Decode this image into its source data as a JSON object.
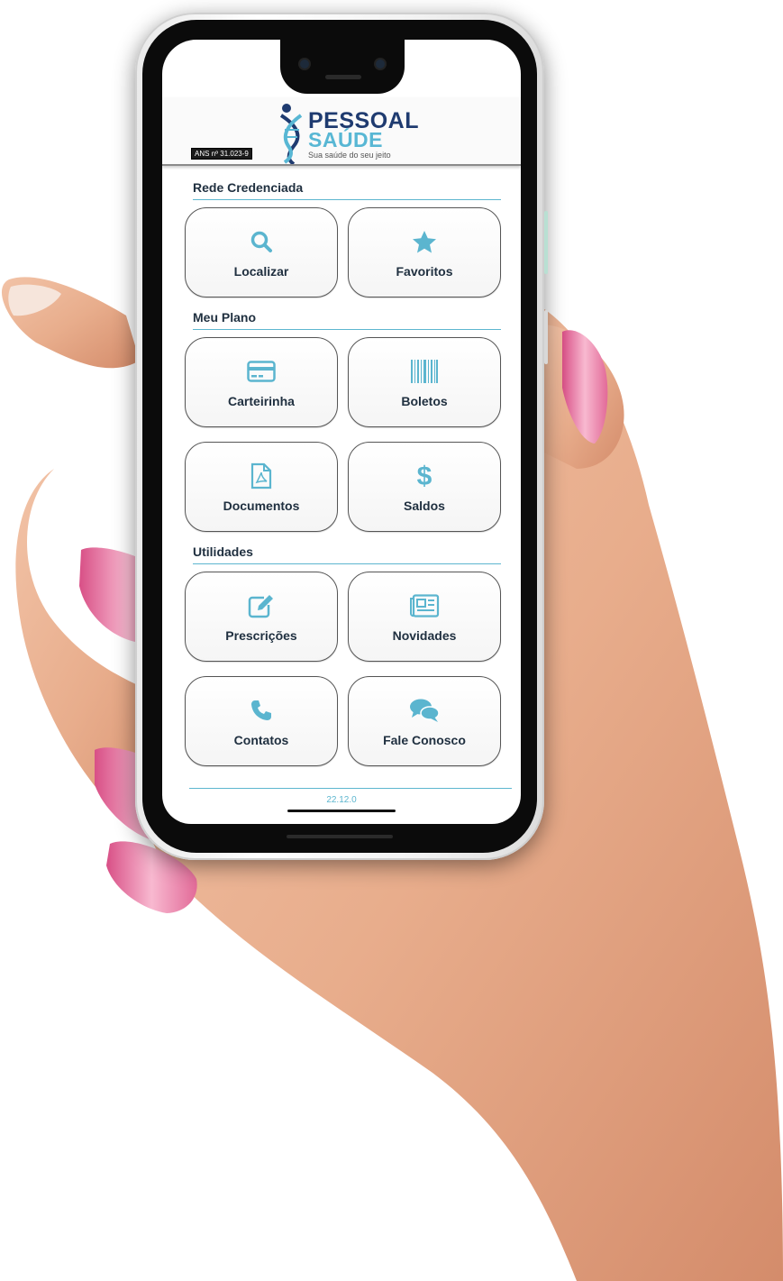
{
  "header": {
    "brand_line1": "PESSOAL",
    "brand_line2": "SAÚDE",
    "tagline": "Sua saúde do seu jeito",
    "ans_badge": "ANS nº 31.023-9"
  },
  "sections": [
    {
      "title": "Rede Credenciada",
      "items": [
        {
          "label": "Localizar",
          "icon": "search-icon"
        },
        {
          "label": "Favoritos",
          "icon": "star-icon"
        }
      ]
    },
    {
      "title": "Meu Plano",
      "items": [
        {
          "label": "Carteirinha",
          "icon": "credit-card-icon"
        },
        {
          "label": "Boletos",
          "icon": "barcode-icon"
        },
        {
          "label": "Documentos",
          "icon": "pdf-file-icon"
        },
        {
          "label": "Saldos",
          "icon": "dollar-icon"
        }
      ]
    },
    {
      "title": "Utilidades",
      "items": [
        {
          "label": "Prescrições",
          "icon": "edit-icon"
        },
        {
          "label": "Novidades",
          "icon": "newspaper-icon"
        },
        {
          "label": "Contatos",
          "icon": "phone-icon"
        },
        {
          "label": "Fale Conosco",
          "icon": "chat-icon"
        }
      ]
    }
  ],
  "footer": {
    "version": "22.12.0"
  },
  "colors": {
    "accent": "#5db6cf",
    "brand_dark": "#1f3b70",
    "icon": "#5bb5cf",
    "nail_pink": "#e7679b"
  }
}
